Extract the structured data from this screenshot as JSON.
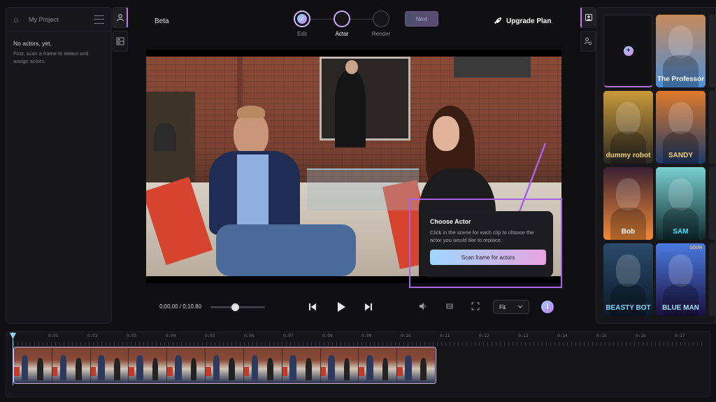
{
  "project": {
    "name": "My Project",
    "empty_title": "No actors, yet.",
    "empty_desc": "First, scan a frame to detect and assign actors."
  },
  "header": {
    "beta": "Beta",
    "steps": [
      {
        "label": "Edit",
        "state": "done"
      },
      {
        "label": "Actor",
        "state": "active"
      },
      {
        "label": "Render",
        "state": "pending"
      }
    ],
    "next_label": "Next",
    "upgrade_label": "Upgrade Plan"
  },
  "tooltip": {
    "title": "Choose Actor",
    "desc": "Click in the scene for each clip to choose the actor you would like to replace.",
    "button": "Scan frame for actors"
  },
  "player": {
    "timecode": "0:00.00 / 0:10.80",
    "progress": 0.45,
    "fit_value": "Fit",
    "info": "i"
  },
  "actors": [
    {
      "name": "The Professor",
      "colors": [
        "#4a8fd8",
        "#c98a5a"
      ],
      "name_color": "#ffffff"
    },
    {
      "name": "dummy robot",
      "colors": [
        "#2a2622",
        "#c99a3a"
      ],
      "name_color": "#f0d27a"
    },
    {
      "name": "SANDY",
      "colors": [
        "#1e3a6a",
        "#e07a2a"
      ],
      "name_color": "#f0d27a"
    },
    {
      "name": "Bob",
      "colors": [
        "#f08a3a",
        "#3a2030"
      ],
      "name_color": "#ffffff"
    },
    {
      "name": "SAM",
      "colors": [
        "#0e2a2e",
        "#7ad0d0"
      ],
      "name_color": "#3fe0ff"
    },
    {
      "name": "BEASTY BOT",
      "colors": [
        "#0a1a2a",
        "#2a4a6a"
      ],
      "name_color": "#7ad8ff"
    },
    {
      "name": "BLUE MAN",
      "colors": [
        "#1a1040",
        "#4a7ae0"
      ],
      "name_color": "#9ee0ff",
      "badge": "SOON"
    }
  ],
  "timeline": {
    "ticks": [
      "0:01",
      "0:02",
      "0:03",
      "0:04",
      "0:05",
      "0:06",
      "0:07",
      "0:08",
      "0:09",
      "0:10",
      "0:11",
      "0:12",
      "0:13",
      "0:14",
      "0:15",
      "0:16",
      "0:17"
    ]
  }
}
